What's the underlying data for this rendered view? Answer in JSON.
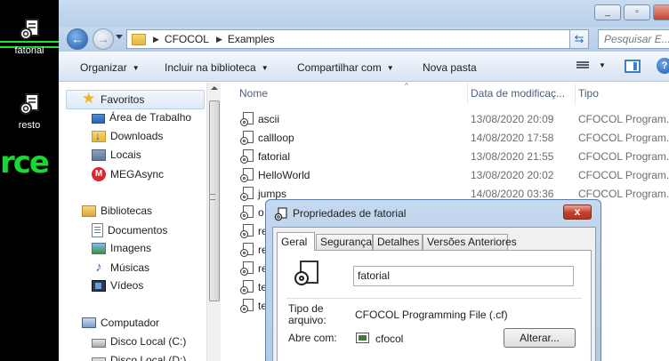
{
  "desktop": {
    "icons": [
      {
        "label": "fatorial"
      },
      {
        "label": "resto"
      }
    ],
    "wallpaper_text": "rce"
  },
  "explorer": {
    "address": {
      "crumbs": [
        "CFOCOL",
        "Examples"
      ]
    },
    "search": {
      "placeholder": "Pesquisar E..."
    },
    "toolbar": {
      "organize": "Organizar",
      "include_library": "Incluir na biblioteca",
      "share": "Compartilhar com",
      "new_folder": "Nova pasta"
    },
    "nav": {
      "favorites": "Favoritos",
      "desktop": "Área de Trabalho",
      "downloads": "Downloads",
      "places": "Locais",
      "mega": "MEGAsync",
      "libraries": "Bibliotecas",
      "documents": "Documentos",
      "images": "Imagens",
      "music": "Músicas",
      "videos": "Vídeos",
      "computer": "Computador",
      "disk_c": "Disco Local (C:)",
      "disk_d": "Disco Local (D:)"
    },
    "columns": {
      "name": "Nome",
      "date": "Data de modificaç...",
      "type": "Tipo"
    },
    "files": [
      {
        "name": "ascii",
        "date": "13/08/2020 20:09",
        "type": "CFOCOL Program..."
      },
      {
        "name": "callloop",
        "date": "14/08/2020 17:58",
        "type": "CFOCOL Program..."
      },
      {
        "name": "fatorial",
        "date": "13/08/2020 21:55",
        "type": "CFOCOL Program..."
      },
      {
        "name": "HelloWorld",
        "date": "13/08/2020 20:02",
        "type": "CFOCOL Program..."
      },
      {
        "name": "jumps",
        "date": "14/08/2020 03:36",
        "type": "CFOCOL Program..."
      },
      {
        "name": "o",
        "date": "",
        "type": ""
      },
      {
        "name": "re",
        "date": "",
        "type": ""
      },
      {
        "name": "re",
        "date": "",
        "type": ""
      },
      {
        "name": "re",
        "date": "",
        "type": ""
      },
      {
        "name": "te",
        "date": "",
        "type": ""
      },
      {
        "name": "te",
        "date": "",
        "type": ""
      }
    ]
  },
  "dialog": {
    "title": "Propriedades de fatorial",
    "close": "x",
    "tabs": [
      "Geral",
      "Segurança",
      "Detalhes",
      "Versões Anteriores"
    ],
    "filename": "fatorial",
    "file_type_label": "Tipo de arquivo:",
    "file_type_value": "CFOCOL Programming File (.cf)",
    "opens_with_label": "Abre com:",
    "opens_with_value": "cfocol",
    "change_button": "Alterar..."
  }
}
